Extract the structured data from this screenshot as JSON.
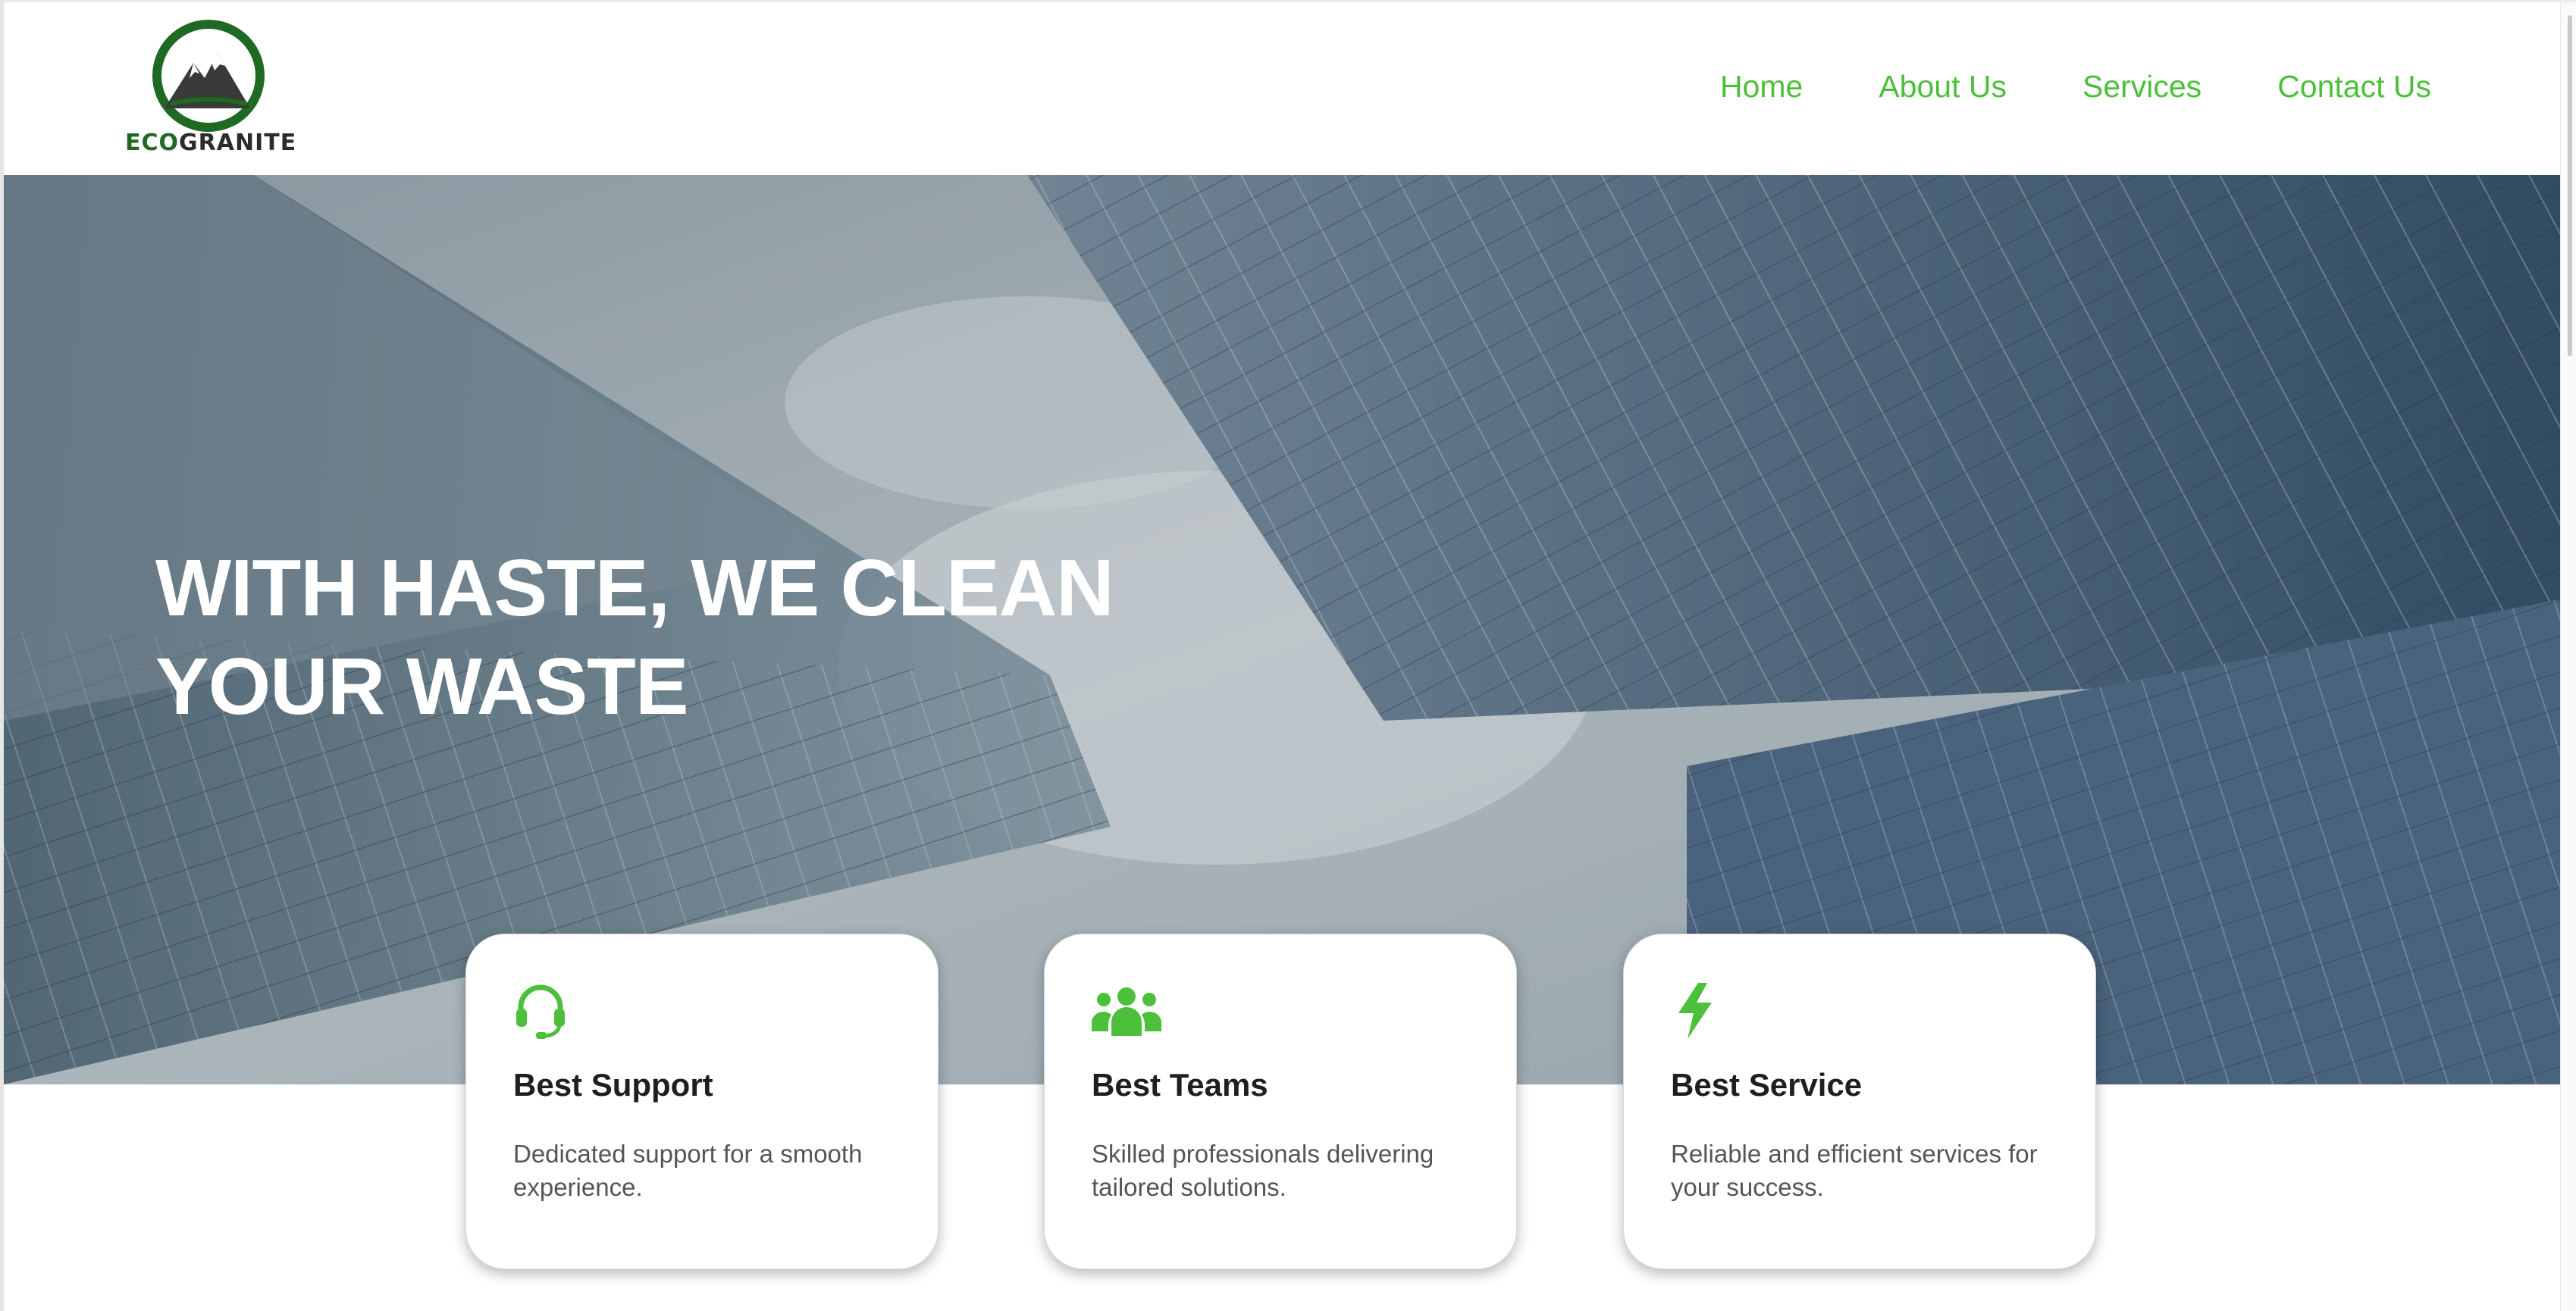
{
  "brand": {
    "logo_text_eco": "ECO",
    "logo_text_rest": "GRANITE",
    "accent_color": "#4cc03a",
    "logo_green": "#1f6a23"
  },
  "nav": {
    "items": [
      {
        "label": "Home"
      },
      {
        "label": "About Us"
      },
      {
        "label": "Services"
      },
      {
        "label": "Contact Us"
      }
    ]
  },
  "hero": {
    "title_line1": "WITH HASTE, WE CLEAN",
    "title_line2": "YOUR WASTE"
  },
  "features": [
    {
      "icon": "headset-icon",
      "title": "Best Support",
      "description": "Dedicated support for a smooth experience."
    },
    {
      "icon": "users-icon",
      "title": "Best Teams",
      "description": "Skilled professionals delivering tailored solutions."
    },
    {
      "icon": "lightning-icon",
      "title": "Best Service",
      "description": "Reliable and efficient services for your success."
    }
  ]
}
